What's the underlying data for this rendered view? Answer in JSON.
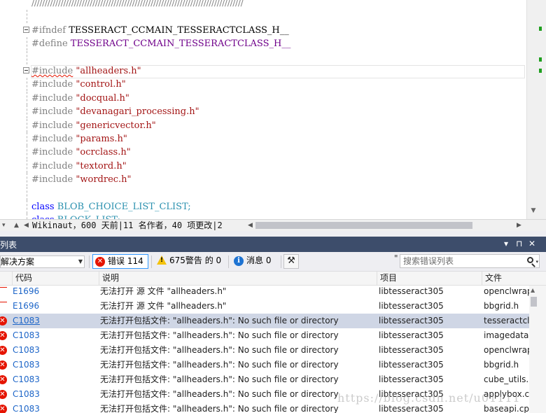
{
  "editor": {
    "lines": [
      {
        "type": "comment-rule",
        "text": "////////////////////////////////////////////////////////////////////////////////"
      },
      {
        "type": "blank"
      },
      {
        "type": "ifndef",
        "directive": "#ifndef",
        "macro": "TESSERACT_CCMAIN_TESSERACTCLASS_H__",
        "collapsible": true
      },
      {
        "type": "define",
        "directive": "#define",
        "macro": "TESSERACT_CCMAIN_TESSERACTCLASS_H__"
      },
      {
        "type": "blank"
      },
      {
        "type": "include",
        "directive": "#include",
        "file": "\"allheaders.h\"",
        "collapsible": true,
        "error": true
      },
      {
        "type": "include",
        "directive": "#include",
        "file": "\"control.h\""
      },
      {
        "type": "include",
        "directive": "#include",
        "file": "\"docqual.h\""
      },
      {
        "type": "include",
        "directive": "#include",
        "file": "\"devanagari_processing.h\""
      },
      {
        "type": "include",
        "directive": "#include",
        "file": "\"genericvector.h\""
      },
      {
        "type": "include",
        "directive": "#include",
        "file": "\"params.h\""
      },
      {
        "type": "include",
        "directive": "#include",
        "file": "\"ocrclass.h\""
      },
      {
        "type": "include",
        "directive": "#include",
        "file": "\"textord.h\""
      },
      {
        "type": "include",
        "directive": "#include",
        "file": "\"wordrec.h\""
      },
      {
        "type": "blank"
      },
      {
        "type": "class",
        "keyword": "class",
        "name": "BLOB_CHOICE_LIST_CLIST;"
      },
      {
        "type": "class",
        "keyword": "class",
        "name": "BLOCK_LIST;"
      }
    ]
  },
  "nav_bar": {
    "info": "Wikinaut，600 天前|11 名作者，40 项更改|2"
  },
  "panel": {
    "title": "列表",
    "pin_label": "▾ ⊓ ✕"
  },
  "toolbar": {
    "scope": "解决方案",
    "errors_label": "错误 114",
    "warnings_label": "675警告 的 0",
    "messages_label": "消息 0",
    "search_placeholder": "搜索错误列表"
  },
  "table": {
    "headers": {
      "code": "代码",
      "description": "说明",
      "project": "项目",
      "file": "文件"
    },
    "rows": [
      {
        "icon": "abc",
        "code": "E1696",
        "description": "无法打开 源 文件 \"allheaders.h\"",
        "project": "libtesseract305",
        "file": "openclwrap"
      },
      {
        "icon": "abc",
        "code": "E1696",
        "description": "无法打开 源 文件 \"allheaders.h\"",
        "project": "libtesseract305",
        "file": "bbgrid.h"
      },
      {
        "icon": "error",
        "code": "C1083",
        "description": "无法打开包括文件: \"allheaders.h\": No such file or directory",
        "project": "libtesseract305",
        "file": "tesseractcla",
        "selected": true
      },
      {
        "icon": "error",
        "code": "C1083",
        "description": "无法打开包括文件: \"allheaders.h\": No such file or directory",
        "project": "libtesseract305",
        "file": "imagedata."
      },
      {
        "icon": "error",
        "code": "C1083",
        "description": "无法打开包括文件: \"allheaders.h\": No such file or directory",
        "project": "libtesseract305",
        "file": "openclwrap"
      },
      {
        "icon": "error",
        "code": "C1083",
        "description": "无法打开包括文件: \"allheaders.h\": No such file or directory",
        "project": "libtesseract305",
        "file": "bbgrid.h"
      },
      {
        "icon": "error",
        "code": "C1083",
        "description": "无法打开包括文件: \"allheaders.h\": No such file or directory",
        "project": "libtesseract305",
        "file": "cube_utils.h"
      },
      {
        "icon": "error",
        "code": "C1083",
        "description": "无法打开包括文件: \"allheaders.h\": No such file or directory",
        "project": "libtesseract305",
        "file": "applybox.c"
      },
      {
        "icon": "error",
        "code": "C1083",
        "description": "无法打开包括文件: \"allheaders.h\": No such file or directory",
        "project": "libtesseract305",
        "file": "baseapi.cp"
      }
    ]
  },
  "watermark": "https://blog.csdn.net/u01111",
  "colors": {
    "title_bar": "#3d4d6b",
    "selected_row": "#cfd6e5",
    "error": "#e51400",
    "link": "#1e66c8"
  }
}
